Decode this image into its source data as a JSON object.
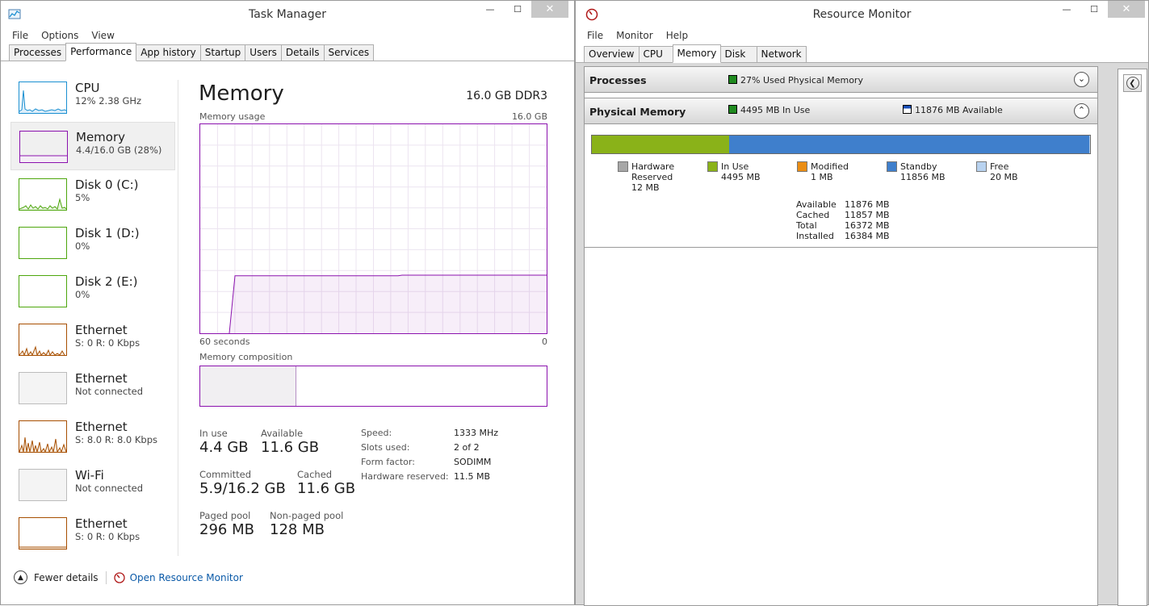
{
  "task_manager": {
    "title": "Task Manager",
    "menu": [
      "File",
      "Options",
      "View"
    ],
    "tabs": [
      "Processes",
      "Performance",
      "App history",
      "Startup",
      "Users",
      "Details",
      "Services"
    ],
    "active_tab": "Performance",
    "sidebar": [
      {
        "name": "CPU",
        "sub": "12%  2.38 GHz",
        "color": "#1a8fd1"
      },
      {
        "name": "Memory",
        "sub": "4.4/16.0 GB (28%)",
        "color": "#8b12ae"
      },
      {
        "name": "Disk 0 (C:)",
        "sub": "5%",
        "color": "#4da60c"
      },
      {
        "name": "Disk 1 (D:)",
        "sub": "0%",
        "color": "#4da60c"
      },
      {
        "name": "Disk 2 (E:)",
        "sub": "0%",
        "color": "#4da60c"
      },
      {
        "name": "Ethernet",
        "sub": "S: 0  R: 0 Kbps",
        "color": "#a74f01"
      },
      {
        "name": "Ethernet",
        "sub": "Not connected",
        "color": "#bcbcbc"
      },
      {
        "name": "Ethernet",
        "sub": "S: 8.0  R: 8.0 Kbps",
        "color": "#a74f01"
      },
      {
        "name": "Wi-Fi",
        "sub": "Not connected",
        "color": "#bcbcbc"
      },
      {
        "name": "Ethernet",
        "sub": "S: 0  R: 0 Kbps",
        "color": "#a74f01"
      }
    ],
    "memory": {
      "title": "Memory",
      "spec": "16.0 GB DDR3",
      "usage_label": "Memory usage",
      "usage_max": "16.0 GB",
      "time_left": "60 seconds",
      "time_right": "0",
      "composition_label": "Memory composition",
      "usage_fraction": 0.275,
      "composition_inuse_fraction": 0.277,
      "stats": {
        "in_use_label": "In use",
        "in_use": "4.4 GB",
        "available_label": "Available",
        "available": "11.6 GB",
        "committed_label": "Committed",
        "committed": "5.9/16.2 GB",
        "cached_label": "Cached",
        "cached": "11.6 GB",
        "paged_label": "Paged pool",
        "paged": "296 MB",
        "nonpaged_label": "Non-paged pool",
        "nonpaged": "128 MB"
      },
      "specs": [
        {
          "label": "Speed:",
          "value": "1333 MHz"
        },
        {
          "label": "Slots used:",
          "value": "2 of 2"
        },
        {
          "label": "Form factor:",
          "value": "SODIMM"
        },
        {
          "label": "Hardware reserved:",
          "value": "11.5 MB"
        }
      ]
    },
    "footer": {
      "fewer": "Fewer details",
      "open_rm": "Open Resource Monitor"
    }
  },
  "resource_monitor": {
    "title": "Resource Monitor",
    "menu": [
      "File",
      "Monitor",
      "Help"
    ],
    "tabs": [
      "Overview",
      "CPU",
      "Memory",
      "Disk",
      "Network"
    ],
    "active_tab": "Memory",
    "processes": {
      "title": "Processes",
      "status": "27% Used Physical Memory"
    },
    "physical": {
      "title": "Physical Memory",
      "in_use_text": "4495 MB In Use",
      "available_text": "11876 MB Available",
      "bar": {
        "hardware": 12,
        "in_use": 4495,
        "modified": 1,
        "standby": 11856,
        "free": 20
      },
      "legend": [
        {
          "line1": "Hardware",
          "line2": "Reserved",
          "line3": "12 MB",
          "color": "#a7a7a7"
        },
        {
          "line1": "In Use",
          "line2": "4495 MB",
          "line3": "",
          "color": "#8ab219"
        },
        {
          "line1": "Modified",
          "line2": "1 MB",
          "line3": "",
          "color": "#ea8d14"
        },
        {
          "line1": "Standby",
          "line2": "11856 MB",
          "line3": "",
          "color": "#3f7fcc"
        },
        {
          "line1": "Free",
          "line2": "20 MB",
          "line3": "",
          "color": "#b8d2ef"
        }
      ],
      "summary": [
        {
          "label": "Available",
          "value": "11876 MB"
        },
        {
          "label": "Cached",
          "value": "11857 MB"
        },
        {
          "label": "Total",
          "value": "16372 MB"
        },
        {
          "label": "Installed",
          "value": "16384 MB"
        }
      ]
    }
  }
}
